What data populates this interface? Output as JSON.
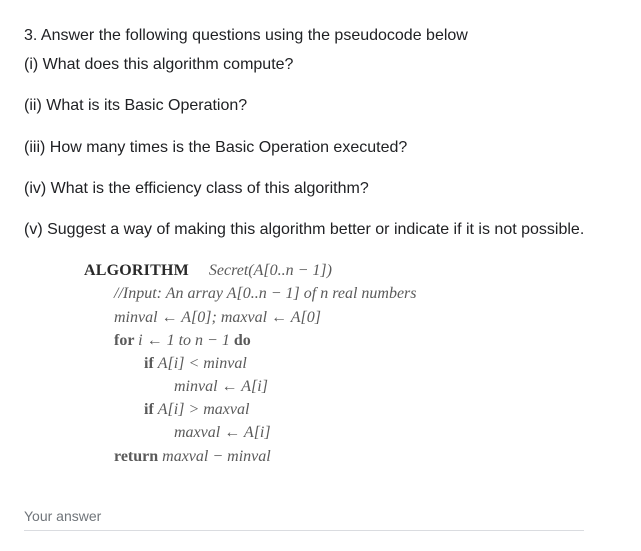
{
  "question": {
    "title": "3. Answer the following questions using the pseudocode below",
    "parts": {
      "i": "(i) What does this algorithm compute?",
      "ii": "(ii) What is its Basic Operation?",
      "iii": "(iii) How many times is the Basic Operation executed?",
      "iv": "(iv) What is the efficiency class of this algorithm?",
      "v": "(v) Suggest a way of making this algorithm better or indicate if it is not possible."
    }
  },
  "algorithm": {
    "header_kw": "ALGORITHM",
    "header_name": "Secret(A[0..n − 1])",
    "line_input": "//Input: An array A[0..n − 1] of n real numbers",
    "line_init": "minval ← A[0]; maxval ← A[0]",
    "line_for_prefix": "for ",
    "line_for_body": "i ← 1 to n − 1 ",
    "line_for_do": "do",
    "line_if1_prefix": "if ",
    "line_if1_body": "A[i] < minval",
    "line_assign1": "minval ← A[i]",
    "line_if2_prefix": "if ",
    "line_if2_body": "A[i] > maxval",
    "line_assign2": "maxval ← A[i]",
    "line_return_prefix": "return ",
    "line_return_body": "maxval − minval"
  },
  "answer": {
    "placeholder": "Your answer"
  },
  "chart_data": {
    "type": "table",
    "note": "Pseudocode algorithm Secret computing max minus min of an array",
    "algorithm_name": "Secret(A[0..n-1])",
    "input": "An array A[0..n-1] of n real numbers",
    "steps": [
      "minval ← A[0]; maxval ← A[0]",
      "for i ← 1 to n − 1 do",
      "  if A[i] < minval",
      "    minval ← A[i]",
      "  if A[i] > maxval",
      "    maxval ← A[i]",
      "return maxval − minval"
    ]
  }
}
